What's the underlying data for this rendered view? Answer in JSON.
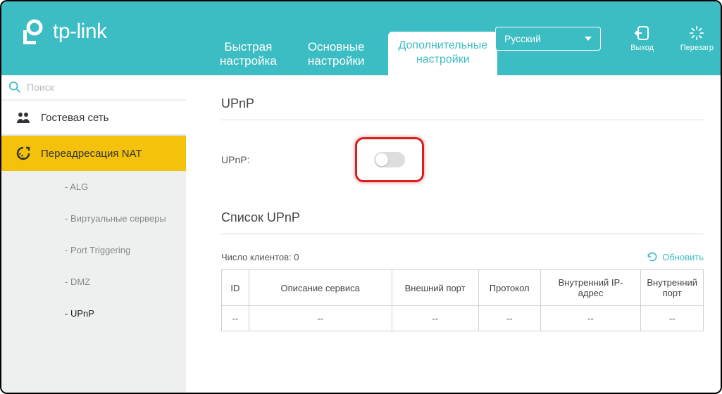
{
  "brand": "tp-link",
  "tabs": {
    "quick": "Быстрая\nнастройка",
    "basic": "Основные\nнастройки",
    "advanced": "Дополнительные\nнастройки"
  },
  "language": "Русский",
  "header_buttons": {
    "exit": "Выход",
    "reboot": "Перезагр"
  },
  "search": {
    "placeholder": "Поиск"
  },
  "sidebar": {
    "guest": "Гостевая сеть",
    "nat": "Переадресация NAT",
    "sub": {
      "alg": "- ALG",
      "vs": "- Виртуальные серверы",
      "pt": "- Port Triggering",
      "dmz": "- DMZ",
      "upnp": "- UPnP"
    }
  },
  "main": {
    "section_upnp": "UPnP",
    "label_upnp": "UPnP:",
    "section_list": "Список UPnP",
    "clients_label": "Число клиентов: 0",
    "refresh": "Обновить",
    "columns": {
      "id": "ID",
      "desc": "Описание сервиса",
      "ext": "Внешний порт",
      "proto": "Протокол",
      "ip": "Внутренний IP-адрес",
      "int": "Внутренний порт"
    },
    "empty": "--"
  }
}
